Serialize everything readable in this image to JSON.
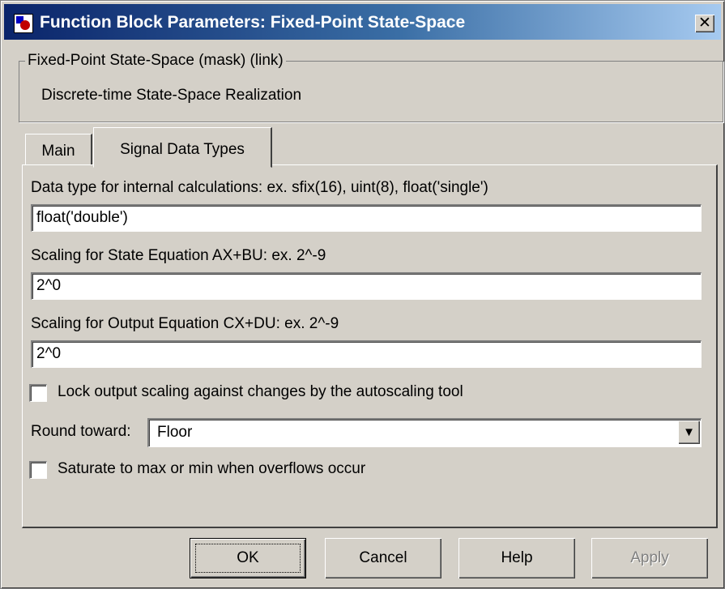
{
  "window": {
    "title": "Function Block Parameters: Fixed-Point State-Space",
    "close_glyph": "✕"
  },
  "mask": {
    "legend": "Fixed-Point State-Space (mask) (link)",
    "description": "Discrete-time State-Space Realization"
  },
  "tabs": [
    {
      "label": "Main",
      "active": false
    },
    {
      "label": "Signal Data Types",
      "active": true
    }
  ],
  "params": {
    "internal_dtype_label": "Data type for internal calculations:    ex.  sfix(16),  uint(8),  float('single')",
    "internal_dtype_value": "float('double')",
    "state_scaling_label": "Scaling for State Equation AX+BU:   ex.  2^-9",
    "state_scaling_value": "2^0",
    "output_scaling_label": "Scaling for Output Equation CX+DU:   ex.  2^-9",
    "output_scaling_value": "2^0",
    "lock_label": "Lock output scaling against changes by the autoscaling tool",
    "lock_checked": false,
    "round_label": "Round toward:",
    "round_value": "Floor",
    "saturate_label": "Saturate to max or min when overflows occur",
    "saturate_checked": false
  },
  "buttons": {
    "ok": "OK",
    "cancel": "Cancel",
    "help": "Help",
    "apply": "Apply"
  },
  "colors": {
    "face": "#d4d0c8",
    "title_start": "#0a246a",
    "title_end": "#a6caf0"
  },
  "icons": {
    "app": "simulink-block-icon",
    "close": "close-icon",
    "dropdown": "chevron-down-icon"
  }
}
